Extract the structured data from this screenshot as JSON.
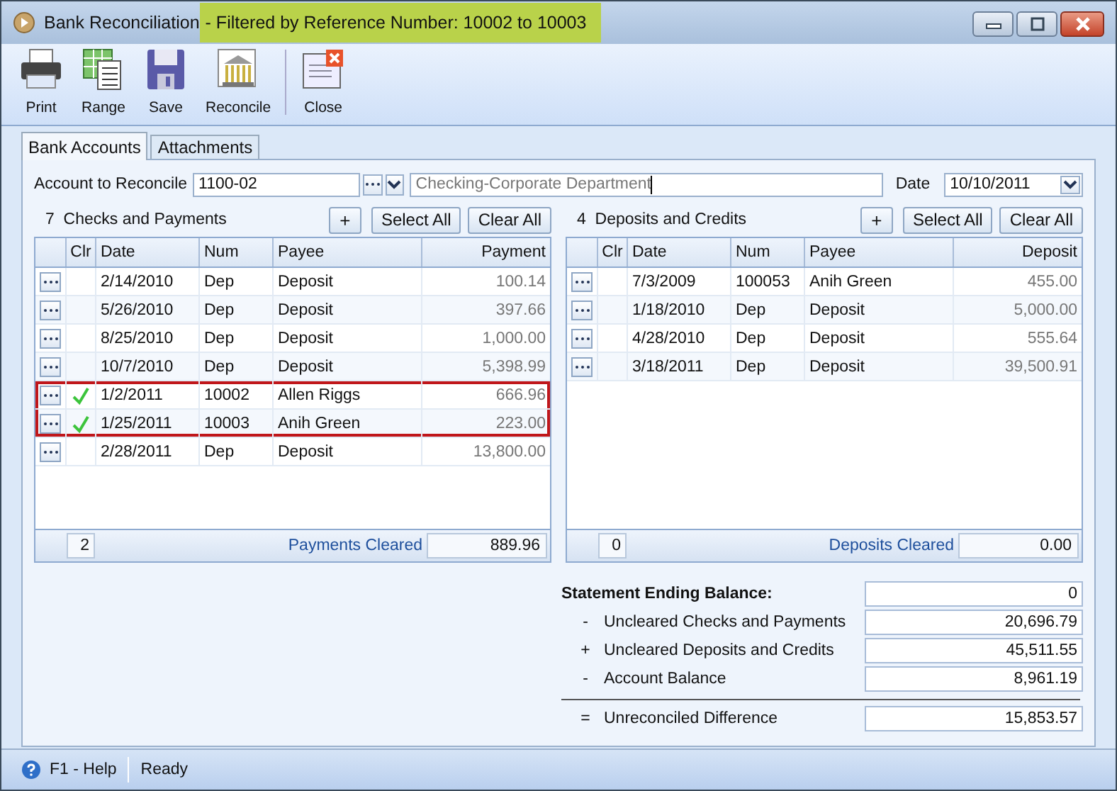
{
  "window": {
    "title": "Bank Reconciliation",
    "filter_note": "- Filtered by Reference Number: 10002 to 10003"
  },
  "toolbar": [
    {
      "kind": "print",
      "label": "Print"
    },
    {
      "kind": "range",
      "label": "Range"
    },
    {
      "kind": "save",
      "label": "Save"
    },
    {
      "kind": "reconcile",
      "label": "Reconcile"
    },
    {
      "kind": "close",
      "label": "Close"
    }
  ],
  "tabs": [
    {
      "label": "Bank Accounts",
      "selected": true
    },
    {
      "label": "Attachments",
      "selected": false
    }
  ],
  "account": {
    "label": "Account to Reconcile",
    "value": "1100-02",
    "description": "Checking-Corporate Department",
    "date_label": "Date",
    "date": "10/10/2011"
  },
  "grids": [
    {
      "count": "7",
      "title": "Checks and Payments",
      "add": "+",
      "select_all": "Select All",
      "clear_all": "Clear All",
      "columns": [
        "Clr",
        "Date",
        "Num",
        "Payee",
        "Payment"
      ],
      "rows": [
        {
          "cleared": false,
          "highlighted": false,
          "date": "2/14/2010",
          "num": "Dep",
          "payee": "Deposit",
          "amount": "100.14"
        },
        {
          "cleared": false,
          "highlighted": false,
          "date": "5/26/2010",
          "num": "Dep",
          "payee": "Deposit",
          "amount": "397.66"
        },
        {
          "cleared": false,
          "highlighted": false,
          "date": "8/25/2010",
          "num": "Dep",
          "payee": "Deposit",
          "amount": "1,000.00"
        },
        {
          "cleared": false,
          "highlighted": false,
          "date": "10/7/2010",
          "num": "Dep",
          "payee": "Deposit",
          "amount": "5,398.99"
        },
        {
          "cleared": true,
          "highlighted": true,
          "date": "1/2/2011",
          "num": "10002",
          "payee": "Allen Riggs",
          "amount": "666.96"
        },
        {
          "cleared": true,
          "highlighted": true,
          "date": "1/25/2011",
          "num": "10003",
          "payee": "Anih Green",
          "amount": "223.00"
        },
        {
          "cleared": false,
          "highlighted": false,
          "date": "2/28/2011",
          "num": "Dep",
          "payee": "Deposit",
          "amount": "13,800.00"
        }
      ],
      "footer": {
        "count": "2",
        "label": "Payments Cleared",
        "total": "889.96"
      }
    },
    {
      "count": "4",
      "title": "Deposits and Credits",
      "add": "+",
      "select_all": "Select All",
      "clear_all": "Clear All",
      "columns": [
        "Clr",
        "Date",
        "Num",
        "Payee",
        "Deposit"
      ],
      "rows": [
        {
          "cleared": false,
          "highlighted": false,
          "date": "7/3/2009",
          "num": "100053",
          "payee": "Anih Green",
          "amount": "455.00"
        },
        {
          "cleared": false,
          "highlighted": false,
          "date": "1/18/2010",
          "num": "Dep",
          "payee": "Deposit",
          "amount": "5,000.00"
        },
        {
          "cleared": false,
          "highlighted": false,
          "date": "4/28/2010",
          "num": "Dep",
          "payee": "Deposit",
          "amount": "555.64"
        },
        {
          "cleared": false,
          "highlighted": false,
          "date": "3/18/2011",
          "num": "Dep",
          "payee": "Deposit",
          "amount": "39,500.91"
        }
      ],
      "footer": {
        "count": "0",
        "label": "Deposits Cleared",
        "total": "0.00"
      }
    }
  ],
  "summary": {
    "title": "Statement Ending Balance:",
    "value": "0",
    "rows": [
      {
        "sign": "-",
        "label": "Uncleared Checks and Payments",
        "value": "20,696.79"
      },
      {
        "sign": "+",
        "label": "Uncleared Deposits and Credits",
        "value": "45,511.55"
      },
      {
        "sign": "-",
        "label": "Account Balance",
        "value": "8,961.19"
      }
    ],
    "total": {
      "sign": "=",
      "label": "Unreconciled Difference",
      "value": "15,853.57"
    }
  },
  "status_bar": {
    "help": "F1 - Help",
    "status": "Ready"
  }
}
